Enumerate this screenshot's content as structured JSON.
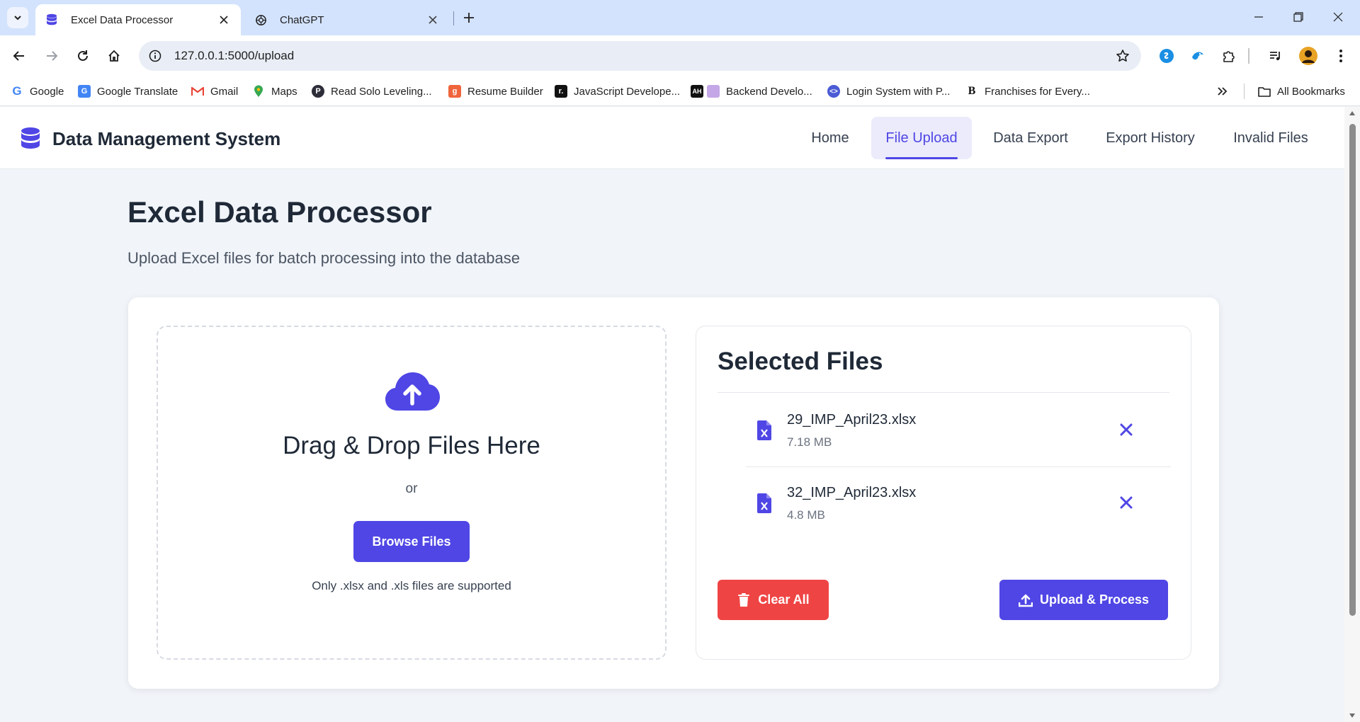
{
  "browser": {
    "tabs": [
      {
        "title": "Excel Data Processor",
        "active": true
      },
      {
        "title": "ChatGPT",
        "active": false
      }
    ],
    "url": "127.0.0.1:5000/upload",
    "bookmarks": [
      {
        "label": "Google",
        "icon": "google-icon"
      },
      {
        "label": "Google Translate",
        "icon": "google-translate-icon"
      },
      {
        "label": "Gmail",
        "icon": "gmail-icon"
      },
      {
        "label": "Maps",
        "icon": "maps-icon"
      },
      {
        "label": "Read Solo Leveling...",
        "icon": "p-logo-icon"
      },
      {
        "label": "Resume Builder",
        "icon": "resume-builder-icon"
      },
      {
        "label": "JavaScript Develope...",
        "icon": "r-logo-icon"
      },
      {
        "label": "Backend Develo...",
        "icon": "backend-icon"
      },
      {
        "label": "Login System with P...",
        "icon": "code-icon"
      },
      {
        "label": "Franchises for Every...",
        "icon": "b-logo-icon"
      }
    ],
    "all_bookmarks": "All Bookmarks"
  },
  "app": {
    "brand": "Data Management System",
    "nav": [
      {
        "label": "Home",
        "active": false
      },
      {
        "label": "File Upload",
        "active": true
      },
      {
        "label": "Data Export",
        "active": false
      },
      {
        "label": "Export History",
        "active": false
      },
      {
        "label": "Invalid Files",
        "active": false
      }
    ]
  },
  "main": {
    "title": "Excel Data Processor",
    "subtitle": "Upload Excel files for batch processing into the database",
    "dropzone": {
      "title": "Drag & Drop Files Here",
      "or": "or",
      "browse_label": "Browse Files",
      "note": "Only .xlsx and .xls files are supported"
    },
    "selected": {
      "title": "Selected Files",
      "files": [
        {
          "name": "29_IMP_April23.xlsx",
          "size": "7.18 MB"
        },
        {
          "name": "32_IMP_April23.xlsx",
          "size": "4.8 MB"
        }
      ],
      "clear_label": "Clear All",
      "upload_label": "Upload & Process"
    }
  },
  "colors": {
    "primary": "#4f46e5",
    "danger": "#ef4444",
    "page_bg": "#f1f4f9",
    "tabstrip": "#d3e3fd"
  }
}
